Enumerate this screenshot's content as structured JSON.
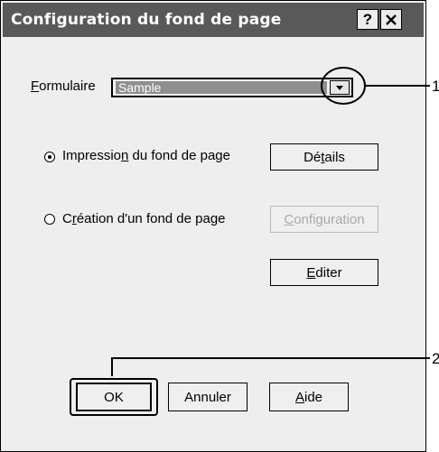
{
  "dialog": {
    "title": "Configuration du fond de page"
  },
  "titlebar": {
    "help_label": "?"
  },
  "form": {
    "label_first": "F",
    "label_rest": "ormulaire",
    "selected_value": "Sample"
  },
  "options": [
    {
      "label_pre": "Impressio",
      "label_u": "n",
      "label_post": " du fond de page",
      "checked": true
    },
    {
      "label_pre": "C",
      "label_u": "r",
      "label_post": "éation d'un fond de page",
      "checked": false
    }
  ],
  "buttons": {
    "details": {
      "pre": "Dé",
      "u": "t",
      "post": "ails"
    },
    "configuration": {
      "pre": "",
      "u": "C",
      "post": "onfiguration",
      "disabled": true
    },
    "editer": {
      "pre": "",
      "u": "E",
      "post": "diter"
    },
    "ok": "OK",
    "annuler": "Annuler",
    "aide": {
      "pre": "",
      "u": "A",
      "post": "ide"
    }
  },
  "callouts": {
    "one": "1",
    "two": "2"
  }
}
